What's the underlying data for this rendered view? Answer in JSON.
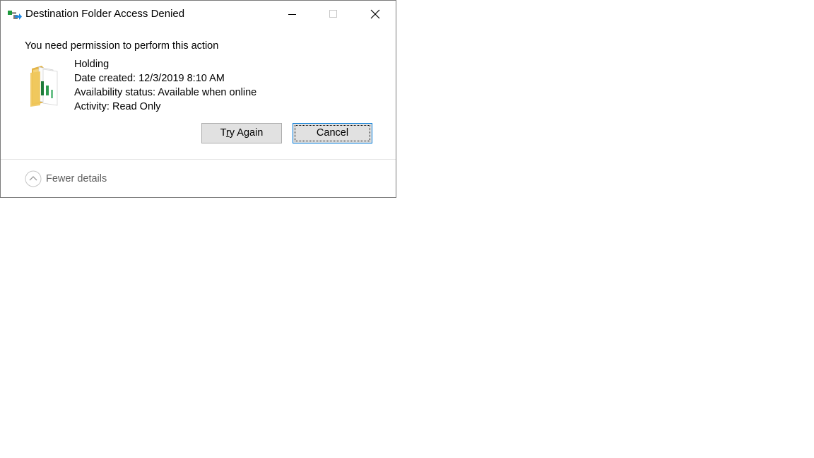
{
  "window": {
    "title": "Destination Folder Access Denied",
    "icon": "file-transfer-icon",
    "controls": {
      "minimize": "minimize-icon",
      "maximize": "maximize-icon",
      "close": "close-icon"
    }
  },
  "message": {
    "heading": "You need permission to perform this action"
  },
  "item": {
    "icon": "folder-icon",
    "name": "Holding",
    "date_created": "Date created: 12/3/2019 8:10 AM",
    "availability": "Availability status: Available when online",
    "activity": "Activity: Read Only"
  },
  "buttons": {
    "try_again_label": "Try Again",
    "try_again_accel": "r",
    "cancel_label": "Cancel"
  },
  "footer": {
    "fewer_details_label": "Fewer details",
    "toggle_icon": "chevron-up-icon"
  },
  "colors": {
    "button_bg": "#e1e1e1",
    "focus_border": "#0078d7",
    "folder_yellow": "#f4d37a"
  }
}
